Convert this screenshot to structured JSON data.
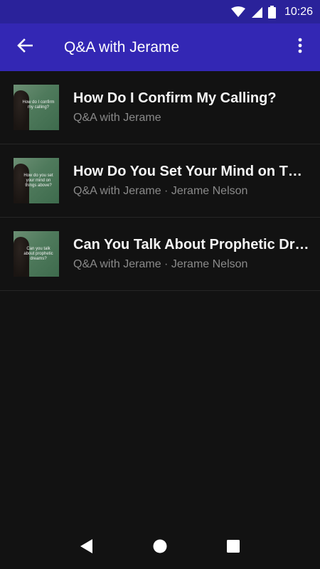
{
  "status_bar": {
    "time": "10:26",
    "icons": [
      "wifi-icon",
      "signal-icon",
      "battery-icon"
    ]
  },
  "app_bar": {
    "title": "Q&A with Jerame",
    "back_icon": "arrow-back-icon",
    "menu_icon": "more-vert-icon"
  },
  "episodes": [
    {
      "title": "How Do I Confirm My Calling?",
      "subtitle": "Q&A with Jerame",
      "thumbnail_text": "How do I confirm my calling?"
    },
    {
      "title": "How Do You Set Your Mind on T…",
      "subtitle": "Q&A with Jerame · Jerame Nelson",
      "thumbnail_text": "How do you set your mind on things above?"
    },
    {
      "title": "Can You Talk About Prophetic Dr…",
      "subtitle": "Q&A with Jerame · Jerame Nelson",
      "thumbnail_text": "Can you talk about prophetic dreams?"
    }
  ],
  "nav_bar": {
    "icons": [
      "nav-back-icon",
      "nav-home-icon",
      "nav-recents-icon"
    ]
  },
  "colors": {
    "status_bar": "#2a229a",
    "app_bar": "#3327b4",
    "background": "#121212",
    "subtitle": "#8a8a8a"
  }
}
